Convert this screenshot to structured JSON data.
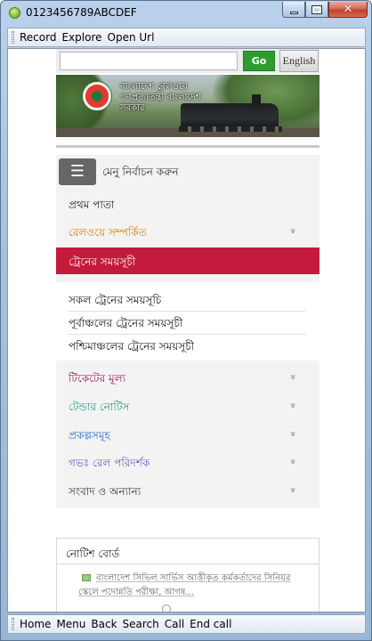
{
  "window": {
    "title": "0123456789ABCDEF",
    "controls": {
      "minimize": "minimize",
      "maximize": "maximize",
      "close": "✕"
    }
  },
  "menubar": {
    "items": [
      "Record",
      "Explore",
      "Open Url"
    ]
  },
  "search": {
    "go_label": "Go",
    "english_label": "English"
  },
  "banner": {
    "line1": "বাংলাদেশ রেলওয়ে",
    "line2": "গণপ্রজাতন্ত্রী বাংলাদেশ",
    "line3": "সরকার"
  },
  "menu": {
    "toggle_icon": "☰",
    "toggle_label": "মেনু নির্বাচন করুন",
    "items": [
      {
        "label": "প্রথম পাতা",
        "color": "#222222",
        "chevron": ""
      },
      {
        "label": "রেলওয়ে সম্পর্কিত",
        "color": "#e07b00",
        "chevron": "»"
      },
      {
        "label": "ট্রেনের সময়সূচী",
        "color": "#ffffff",
        "chevron": ""
      }
    ],
    "sub_items": [
      "সকল ট্রেনের সময়সূচি",
      "পূর্বাঞ্চলের ট্রেনের সময়সূচী",
      "পশ্চিমাঞ্চলের ট্রেনের সময়সূচী"
    ],
    "more_items": [
      {
        "label": "টিকেটের মূল্য",
        "color": "#8b1a56",
        "chevron": "»"
      },
      {
        "label": "টেন্ডার নোটিস",
        "color": "#2a9a7f",
        "chevron": "»"
      },
      {
        "label": "প্রকল্পসমূহ",
        "color": "#2d6cc0",
        "chevron": "»"
      },
      {
        "label": "গভঃ রেল পরিদর্শক",
        "color": "#7a55c7",
        "chevron": "»"
      },
      {
        "label": "সংবাদ ও অন্যান্য",
        "color": "#333333",
        "chevron": "»"
      }
    ]
  },
  "notice_board": {
    "title": "নোটিশ বোর্ড",
    "item_text": "বাংলাদেশ সিভিল সার্ভিস আত্তীকৃত কর্মকর্তাদের সিনিয়র স্কেলে পদোন্নতি পরীক্ষা, আগষ..."
  },
  "bottombar": {
    "items": [
      "Home",
      "Menu",
      "Back",
      "Search",
      "Call",
      "End call"
    ]
  },
  "colors": {
    "active_menu_bg": "#c41a3c",
    "go_button": "#2e9d2e",
    "frame": "#a6c1de"
  }
}
